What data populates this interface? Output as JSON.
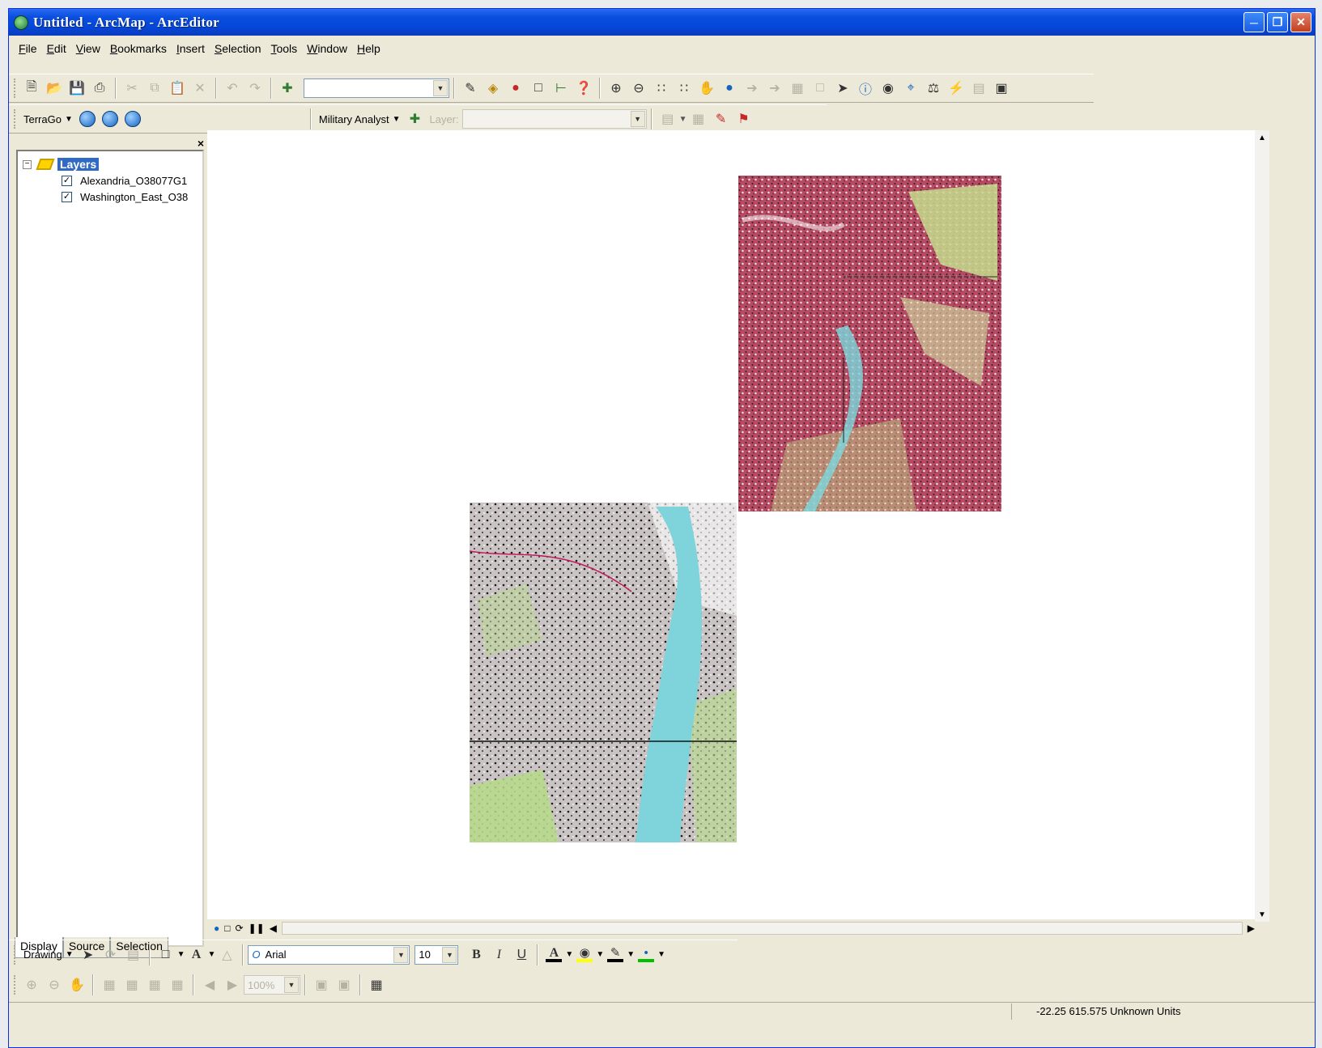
{
  "window": {
    "title": "Untitled - ArcMap - ArcEditor"
  },
  "menu": [
    "File",
    "Edit",
    "View",
    "Bookmarks",
    "Insert",
    "Selection",
    "Tools",
    "Window",
    "Help"
  ],
  "toolbar2": {
    "terrago_label": "TerraGo",
    "military_label": "Military Analyst",
    "layer_label": "Layer:"
  },
  "toc": {
    "root_label": "Layers",
    "layers": [
      {
        "name": "Alexandria_O38077G1",
        "checked": true
      },
      {
        "name": "Washington_East_O38",
        "checked": true
      }
    ],
    "tabs": [
      "Display",
      "Source",
      "Selection"
    ]
  },
  "drawing": {
    "label": "Drawing",
    "font": "Arial",
    "size": "10",
    "zoom": "100%",
    "bold": "B",
    "italic": "I",
    "underline": "U",
    "font_color_glyph": "A"
  },
  "status": {
    "coords": "-22.25  615.575 Unknown Units"
  },
  "colors": {
    "title_bar": "#0a4fe0",
    "selection": "#316ac5",
    "map_bg": "#ffffff"
  }
}
